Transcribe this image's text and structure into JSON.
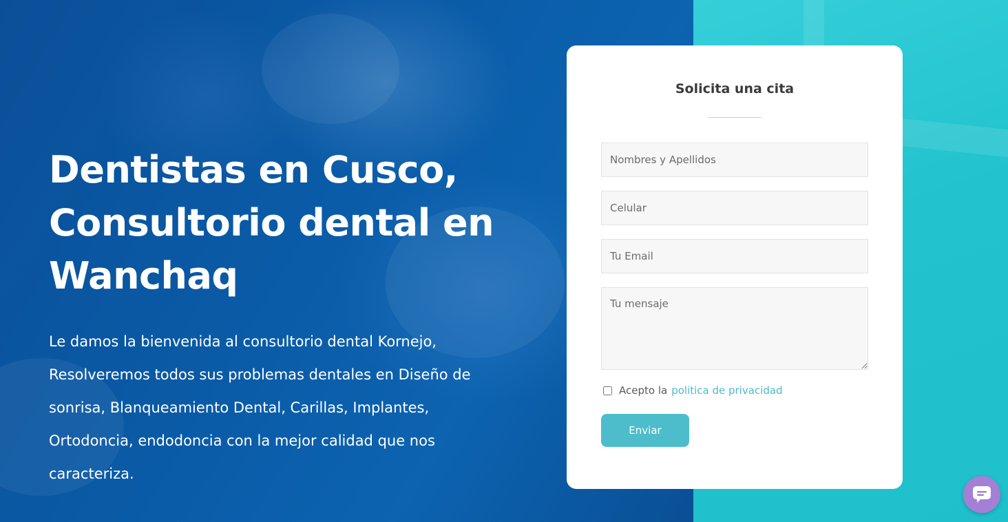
{
  "hero": {
    "title": "Dentistas en Cusco, Consultorio dental en Wanchaq",
    "description": "Le damos la bienvenida al consultorio dental Kornejo, Resolveremos todos sus problemas dentales en Diseño de sonrisa, Blanqueamiento Dental, Carillas, Implantes, Ortodoncia, endodoncia con la mejor calidad que nos caracteriza."
  },
  "form": {
    "title": "Solicita una cita",
    "fields": {
      "name_placeholder": "Nombres y Apellidos",
      "phone_placeholder": "Celular",
      "email_placeholder": "Tu Email",
      "message_placeholder": "Tu mensaje"
    },
    "consent_prefix": "Acepto la",
    "consent_link": "politica de privacidad",
    "submit_label": "Enviar"
  },
  "chat": {
    "icon": "chat-bubble-icon"
  },
  "colors": {
    "hero_blue": "#0b5aa6",
    "hero_cyan": "#22c3ce",
    "accent": "#4dbdcc",
    "chat_purple": "#a37fd6"
  }
}
